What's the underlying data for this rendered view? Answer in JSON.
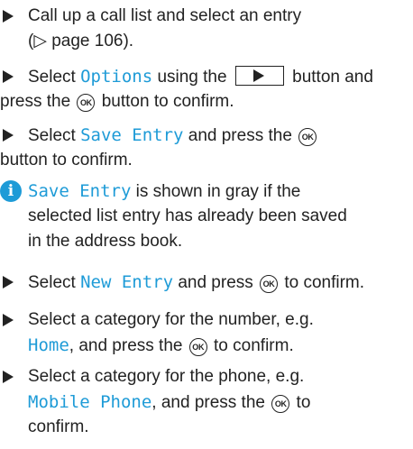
{
  "steps": [
    {
      "p1": "Call up a call list and select an entry",
      "p2": "(▷ page 106)."
    },
    {
      "a": "Select ",
      "hl": "Options",
      "b": " using the",
      "c": "button and",
      "d": "press the",
      "e": "button to confirm."
    },
    {
      "a": "Select ",
      "hl": "Save Entry",
      "b": " and press the",
      "d": "button to confirm."
    },
    {
      "a": "Select ",
      "hl": "New Entry",
      "b": " and press",
      "c": "to confirm."
    },
    {
      "p1": "Select a category for the number, e.g.",
      "hl": "Home",
      "b": ", and press the",
      "c": "to confirm."
    },
    {
      "p1": "Select a category for the phone, e.g.",
      "hl": "Mobile Phone",
      "b": ", and press the",
      "c": "to",
      "d": "confirm."
    }
  ],
  "note": {
    "hl": "Save Entry",
    "l1": " is shown in gray if the",
    "l2": "selected list entry has already been saved",
    "l3": "in the address book.",
    "icon": "info-icon"
  },
  "icons": {
    "ok_label": "OK",
    "bullet": "triangle-bullet-icon",
    "button_icon": "right-arrow-button-icon"
  },
  "colors": {
    "highlight": "#1e9bd7",
    "text": "#222222"
  }
}
